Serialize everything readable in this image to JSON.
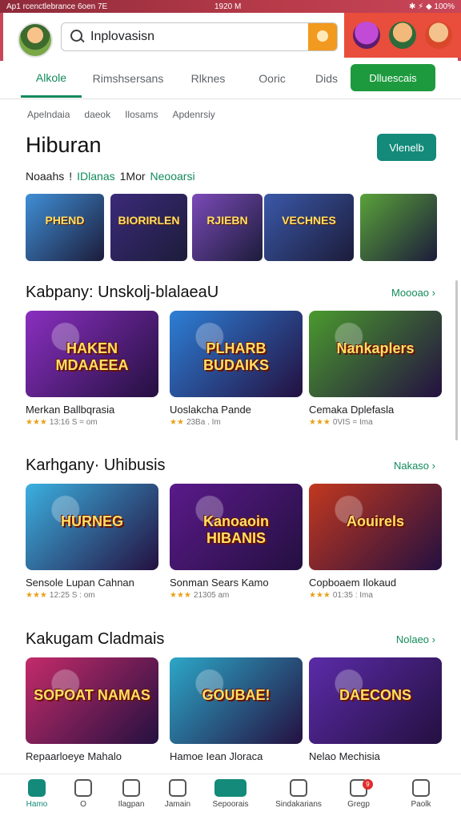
{
  "statusbar": {
    "left": "Ap1 rcenctlebrance 6oen 7E",
    "center": "1920 M",
    "right": "✱ ⚡ ◆ 100%"
  },
  "search": {
    "query": "Inplovasisn"
  },
  "tabs": [
    "Alkole",
    "Rimshsersans",
    "Rlknes",
    "Ooric",
    "Dids"
  ],
  "tab_button": "Dlluescais",
  "chips": [
    "Apelndaia",
    "daeok",
    "Ilosams",
    "Apdenrsiy"
  ],
  "page_title": "Hiburan",
  "view_button": "Vlenelb",
  "subline": {
    "a": "Noaahs",
    "sep": "!",
    "b": "IDlanas",
    "c": "1Mor",
    "d": "Neooarsi"
  },
  "strip": [
    {
      "text": "PHEND",
      "color": "#3f8fd6"
    },
    {
      "text": "BIORIRLEN",
      "color": "#3b2a7a"
    },
    {
      "text": "RJIEBN",
      "color": "#7b4ab8"
    },
    {
      "text": "VECHNES",
      "color": "#3a58a8"
    },
    {
      "text": "",
      "color": "#5aa23a"
    }
  ],
  "sections": [
    {
      "title": "Kabpany: Unskolj-blalaeaU",
      "more": "Moooao",
      "cards": [
        {
          "thumb": "HAKEN MDAAEEA",
          "bg": "#8a2fc0",
          "title": "Merkan Ballbqrasia",
          "meta": "13:16 S = om"
        },
        {
          "thumb": "PLHARB BUDAIKS",
          "bg": "#2d7fd6",
          "title": "Uoslakcha Pande",
          "meta": "23Ba . Im"
        },
        {
          "thumb": "Nankaplers",
          "bg": "#4a9a2e",
          "title": "Cemaka Dplefasla",
          "meta": "0VIS = Ima"
        }
      ]
    },
    {
      "title": "Karhgany· Uhibusis",
      "more": "Nakaso",
      "cards": [
        {
          "thumb": "HURNEG",
          "bg": "#3bb0e0",
          "title": "Sensole Lupan Cahnan",
          "meta": "12:25 S : om"
        },
        {
          "thumb": "Kanoaoin HIBANIS",
          "bg": "#5a1a8a",
          "title": "Sonman Sears Kamo",
          "meta": "21305 am"
        },
        {
          "thumb": "Aouirels",
          "bg": "#c2381f",
          "title": "Copboaem Ilokaud",
          "meta": "01:35 : Ima"
        }
      ]
    },
    {
      "title": "Kakugam Cladmais",
      "more": "Nolaeo",
      "cards": [
        {
          "thumb": "SOPOAT NAMAS",
          "bg": "#c42b6a",
          "title": "Repaarloeye Mahalo",
          "meta": ""
        },
        {
          "thumb": "GOUBAE!",
          "bg": "#2ca7c8",
          "title": "Hamoe Iean Jloraca",
          "meta": ""
        },
        {
          "thumb": "DAECONS",
          "bg": "#5b2ba8",
          "title": "Nelao Mechisia",
          "meta": ""
        }
      ]
    }
  ],
  "bottomnav": [
    {
      "label": "Hamo",
      "icon": "home-icon"
    },
    {
      "label": "O",
      "icon": "lightning-icon"
    },
    {
      "label": "Ilagpan",
      "icon": "games-icon"
    },
    {
      "label": "Jamain",
      "icon": "clock-icon"
    },
    {
      "label": "Sepoorais",
      "icon": "category-icon"
    },
    {
      "label": "Sindakarians",
      "icon": "smile-icon"
    },
    {
      "label": "Gregp",
      "icon": "bell-icon",
      "badge": "9"
    },
    {
      "label": "Paolk",
      "icon": "profile-icon"
    }
  ],
  "colors": {
    "accent": "#128a5c",
    "statusbar": "#b83b4a",
    "teal": "#138a7a"
  }
}
